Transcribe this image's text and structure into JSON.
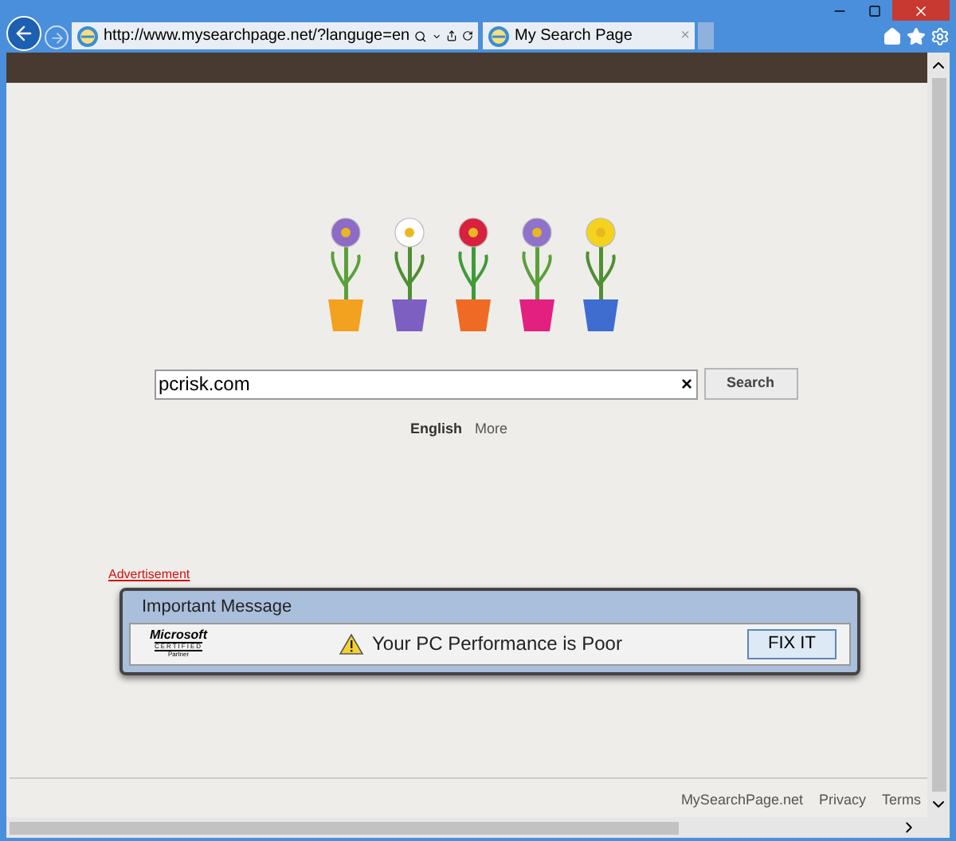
{
  "browser": {
    "address": "http://www.mysearchpage.net/?languge=en",
    "tab": {
      "title": "My Search Page",
      "close": "×"
    }
  },
  "search": {
    "value": "pcrisk.com",
    "clear": "×",
    "button": "Search"
  },
  "languages": [
    {
      "label": "English",
      "selected": true
    },
    {
      "label": "More",
      "selected": false
    }
  ],
  "advert": {
    "label": "Advertisement",
    "dialog": {
      "title": "Important Message",
      "logo": {
        "brand": "Microsoft",
        "line": "CERTIFIED",
        "sub": "Partner"
      },
      "message": "Your PC Performance is Poor",
      "button": "FIX IT"
    }
  },
  "footer": {
    "links": [
      "MySearchPage.net",
      "Privacy",
      "Terms"
    ]
  }
}
